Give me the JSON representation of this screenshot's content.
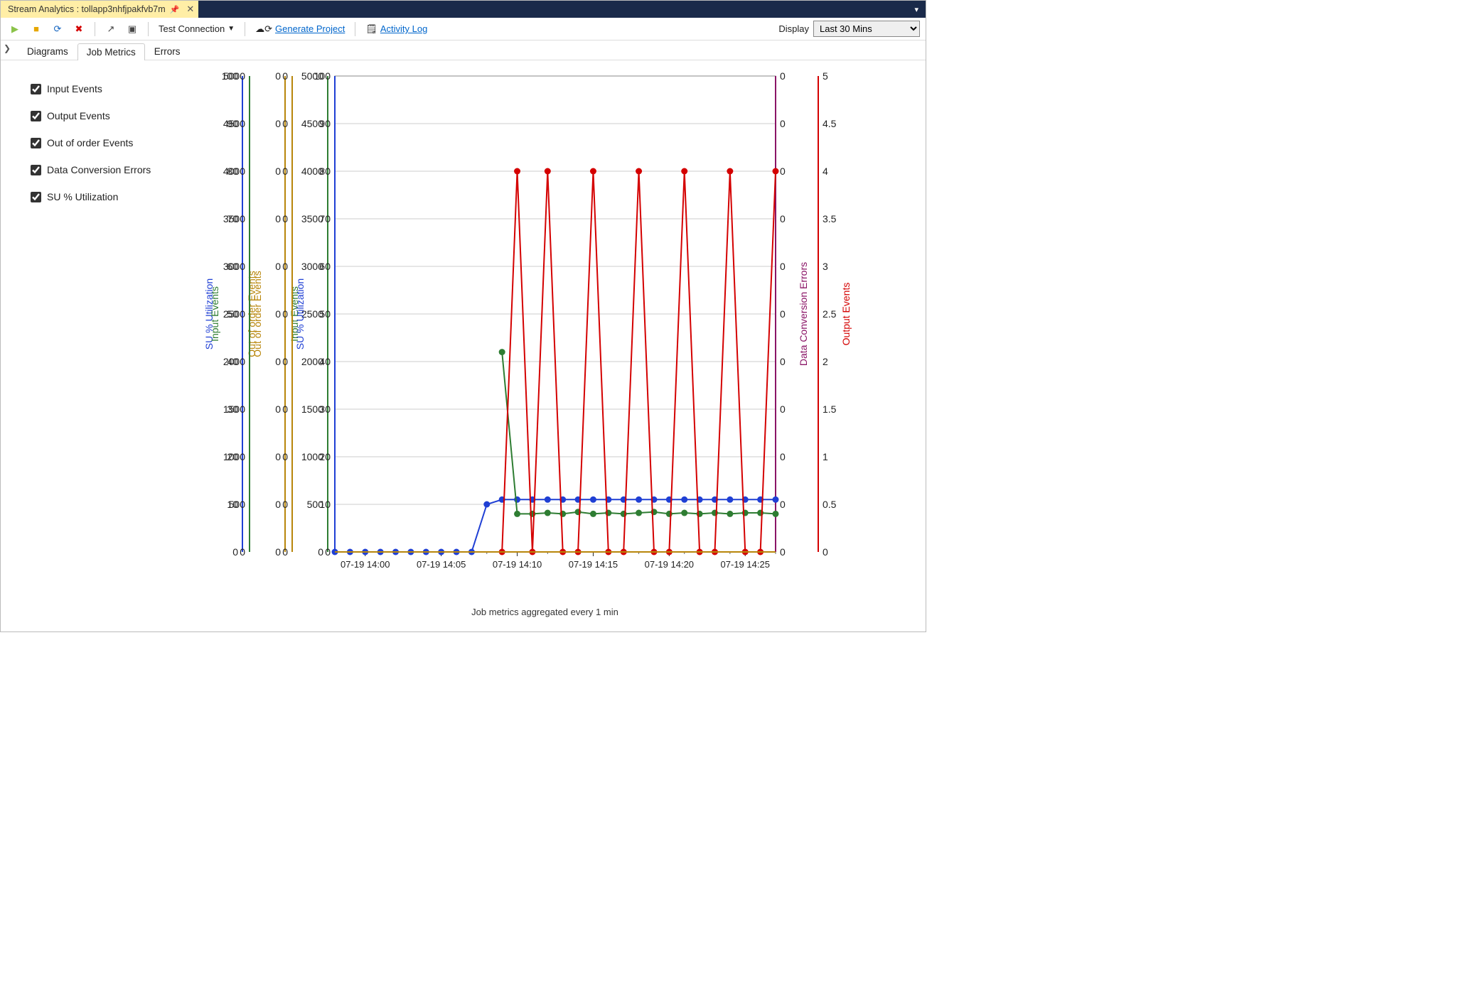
{
  "ide_tab": {
    "title": "Stream Analytics : tollapp3nhfjpakfvb7m"
  },
  "toolbar": {
    "test_connection": "Test Connection",
    "generate_project": "Generate Project",
    "activity_log": "Activity Log",
    "display_label": "Display",
    "display_value": "Last 30 Mins"
  },
  "tabs": {
    "diagrams": "Diagrams",
    "job_metrics": "Job Metrics",
    "errors": "Errors"
  },
  "legend": {
    "input_events": "Input Events",
    "output_events": "Output Events",
    "out_of_order": "Out of order Events",
    "data_conv": "Data Conversion Errors",
    "su_util": "SU % Utilization"
  },
  "caption": "Job metrics aggregated every 1 min",
  "chart_data": {
    "type": "line",
    "xlabel": "",
    "xticks": [
      "07-19 14:00",
      "07-19 14:05",
      "07-19 14:10",
      "07-19 14:15",
      "07-19 14:20",
      "07-19 14:25"
    ],
    "x": [
      0,
      1,
      2,
      3,
      4,
      5,
      6,
      7,
      8,
      9,
      10,
      11,
      12,
      13,
      14,
      15,
      16,
      17,
      18,
      19,
      20,
      21,
      22,
      23,
      24,
      25,
      26,
      27,
      28,
      29
    ],
    "axes": [
      {
        "name": "Input Events",
        "side": "left",
        "color": "#2e7d32",
        "ylim": [
          0,
          5000
        ],
        "ticks": [
          0,
          500,
          1000,
          1500,
          2000,
          2500,
          3000,
          3500,
          4000,
          4500,
          5000
        ]
      },
      {
        "name": "Out of order Events",
        "side": "left",
        "color": "#b8860b",
        "ylim": [
          0,
          0
        ],
        "ticks": [
          0,
          0,
          0,
          0,
          0,
          0,
          0,
          0,
          0,
          0,
          0
        ]
      },
      {
        "name": "SU % Utilization",
        "side": "left",
        "color": "#1f3fd4",
        "ylim": [
          0,
          100
        ],
        "ticks": [
          0,
          10,
          20,
          30,
          40,
          50,
          60,
          70,
          80,
          90,
          100
        ]
      },
      {
        "name": "Data Conversion Errors",
        "side": "right",
        "color": "#8a1466",
        "ylim": [
          0,
          0
        ],
        "ticks": [
          0,
          0,
          0,
          0,
          0,
          0,
          0,
          0,
          0,
          0,
          0
        ]
      },
      {
        "name": "Output Events",
        "side": "right",
        "color": "#d40000",
        "ylim": [
          0,
          5
        ],
        "ticks": [
          0,
          0.5,
          1,
          1.5,
          2,
          2.5,
          3,
          3.5,
          4,
          4.5,
          5
        ]
      }
    ],
    "series": [
      {
        "name": "SU % Utilization",
        "axis": 2,
        "color": "#1f3fd4",
        "markers": true,
        "values": [
          0,
          0,
          0,
          0,
          0,
          0,
          0,
          0,
          0,
          0,
          10,
          11,
          11,
          11,
          11,
          11,
          11,
          11,
          11,
          11,
          11,
          11,
          11,
          11,
          11,
          11,
          11,
          11,
          11,
          11
        ]
      },
      {
        "name": "Input Events",
        "axis": 0,
        "color": "#2e7d32",
        "markers": true,
        "start": 11,
        "values": [
          2100,
          400,
          400,
          410,
          400,
          420,
          400,
          410,
          400,
          410,
          420,
          400,
          410,
          400,
          410,
          400,
          410,
          410,
          400
        ]
      },
      {
        "name": "Output Events",
        "axis": 4,
        "color": "#d40000",
        "markers": true,
        "start": 11,
        "values": [
          0,
          4,
          0,
          4,
          0,
          0,
          4,
          0,
          0,
          4,
          0,
          0,
          4,
          0,
          0,
          4,
          0,
          0,
          4
        ]
      },
      {
        "name": "Data Conversion Errors",
        "axis": 3,
        "color": "#8a1466",
        "markers": false,
        "values": [
          0,
          0,
          0,
          0,
          0,
          0,
          0,
          0,
          0,
          0,
          0,
          0,
          0,
          0,
          0,
          0,
          0,
          0,
          0,
          0,
          0,
          0,
          0,
          0,
          0,
          0,
          0,
          0,
          0,
          0
        ]
      },
      {
        "name": "Out of order Events",
        "axis": 1,
        "color": "#b8860b",
        "markers": false,
        "values": [
          0,
          0,
          0,
          0,
          0,
          0,
          0,
          0,
          0,
          0,
          0,
          0,
          0,
          0,
          0,
          0,
          0,
          0,
          0,
          0,
          0,
          0,
          0,
          0,
          0,
          0,
          0,
          0,
          0,
          0
        ]
      }
    ]
  }
}
